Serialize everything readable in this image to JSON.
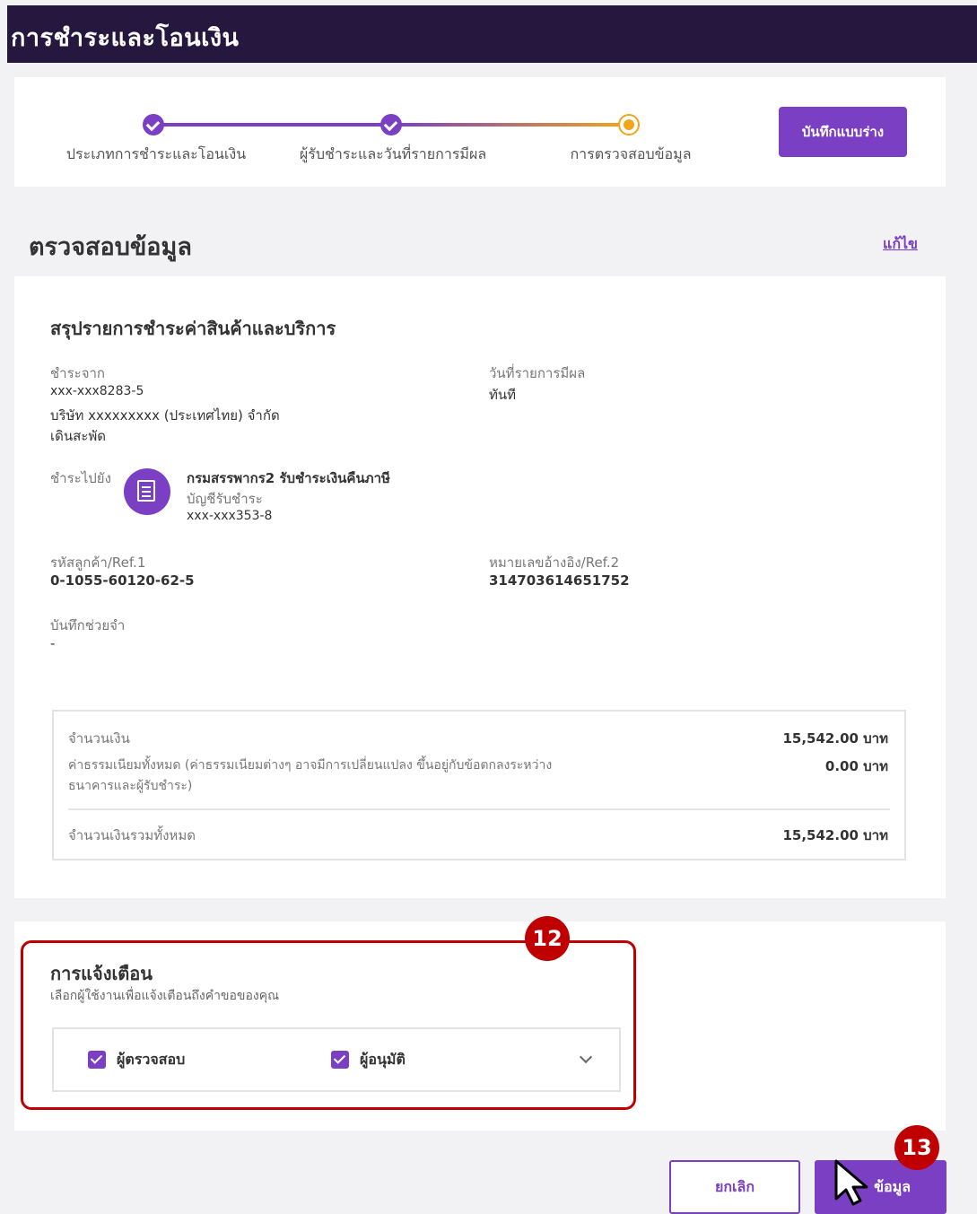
{
  "header": {
    "title": "การชำระและโอนเงิน"
  },
  "stepper": {
    "steps": [
      {
        "label": "ประเภทการชำระและโอนเงิน",
        "state": "done"
      },
      {
        "label": "ผู้รับชำระและวันที่รายการมีผล",
        "state": "done"
      },
      {
        "label": "การตรวจสอบข้อมูล",
        "state": "current"
      }
    ],
    "draft_label": "บันทึกแบบร่าง"
  },
  "review": {
    "title": "ตรวจสอบข้อมูล",
    "edit_label": "แก้ไข",
    "summary_title": "สรุปรายการชำระค่าสินค้าและบริการ",
    "pay_from": {
      "label": "ชำระจาก",
      "account": "xxx-xxx8283-5",
      "company": "บริษัท xxxxxxxxx (ประเทศไทย) จำกัด",
      "type": "เดินสะพัด"
    },
    "effective_date": {
      "label": "วันที่รายการมีผล",
      "value": "ทันที"
    },
    "pay_to": {
      "label": "ชำระไปยัง",
      "biller": "กรมสรรพากร2 รับชำระเงินคืนภาษี",
      "account_label": "บัญชีรับชำระ",
      "account": "xxx-xxx353-8",
      "icon": "document-icon"
    },
    "ref1": {
      "label": "รหัสลูกค้า/Ref.1",
      "value": "0-1055-60120-62-5"
    },
    "ref2": {
      "label": "หมายเลขอ้างอิง/Ref.2",
      "value": "314703614651752"
    },
    "memo": {
      "label": "บันทึกช่วยจำ",
      "value": "-"
    },
    "amounts": {
      "amount_label": "จำนวนเงิน",
      "amount_value": "15,542.00 บาท",
      "fee_label": "ค่าธรรมเนียมทั้งหมด (ค่าธรรมเนียมต่างๆ อาจมีการเปลี่ยนแปลง ขึ้นอยู่กับข้อตกลงระหว่าง",
      "fee_label_2": "ธนาคารและผู้รับชำระ)",
      "fee_value": "0.00 บาท",
      "total_label": "จำนวนเงินรวมทั้งหมด",
      "total_value": "15,542.00 บาท"
    }
  },
  "notification": {
    "title": "การแจ้งเตือน",
    "subtitle": "เลือกผู้ใช้งานเพื่อแจ้งเตือนถึงคำขอของคุณ",
    "options": [
      {
        "label": "ผู้ตรวจสอบ",
        "checked": true
      },
      {
        "label": "ผู้อนุมัติ",
        "checked": true
      }
    ]
  },
  "annotations": {
    "badge_12": "12",
    "badge_13": "13",
    "accent": "#c00000"
  },
  "actions": {
    "cancel_label": "ยกเลิก",
    "confirm_label": "ข้อมูล"
  },
  "colors": {
    "primary": "#7b3fc4",
    "header_bg": "#26173f",
    "progress_current": "#f3a51a"
  }
}
